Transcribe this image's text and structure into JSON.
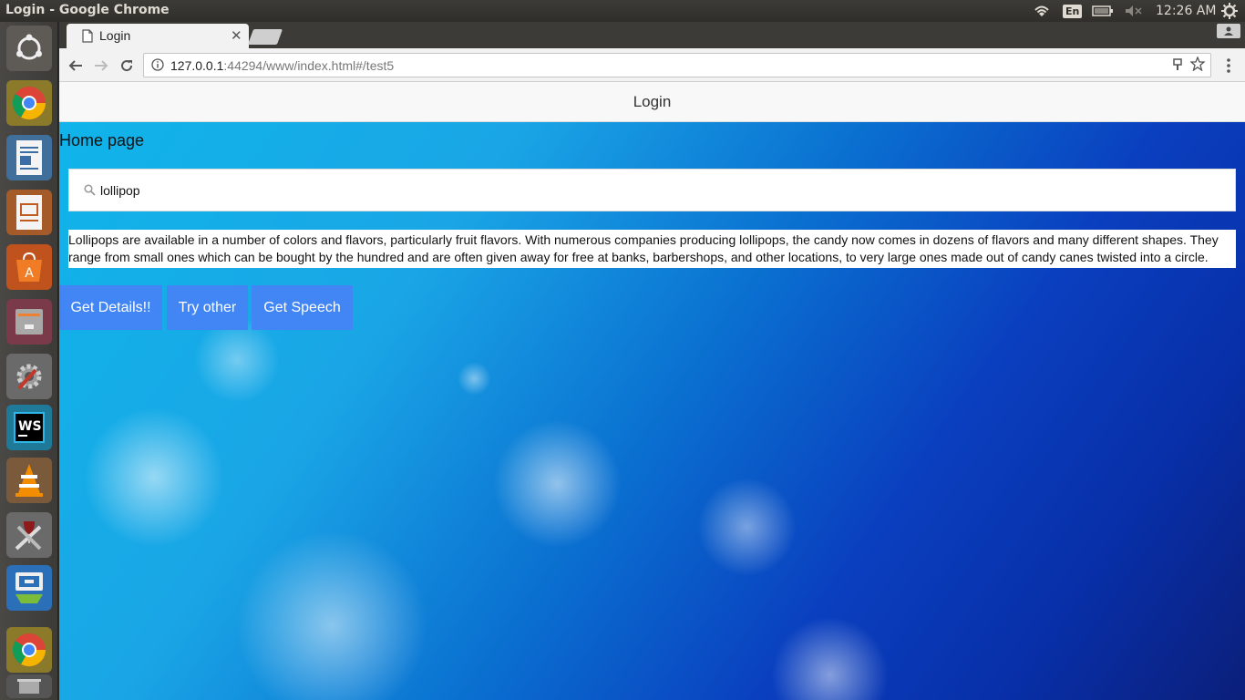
{
  "system": {
    "window_title": "Login - Google Chrome",
    "language": "En",
    "clock": "12:26 AM"
  },
  "launcher": {
    "items": [
      "ubuntu-logo-icon",
      "chrome-icon",
      "writer-icon",
      "impress-icon",
      "software-center-icon",
      "files-icon",
      "settings-icon",
      "webstorm-icon",
      "vlc-icon",
      "wine-tools-icon",
      "screenshot-icon",
      "chrome-icon",
      "trash-icon"
    ]
  },
  "browser": {
    "tab_title": "Login",
    "url_host": "127.0.0.1",
    "url_rest": ":44294/www/index.html#/test5"
  },
  "page": {
    "header_title": "Login",
    "heading": "Home page",
    "search": {
      "value": "lollipop"
    },
    "description": "Lollipops are available in a number of colors and flavors, particularly fruit flavors. With numerous companies producing lollipops, the candy now comes in dozens of flavors and many different shapes. They range from small ones which can be bought by the hundred and are often given away for free at banks, barbershops, and other locations, to very large ones made out of candy canes twisted into a circle.",
    "buttons": {
      "details": "Get Details!!",
      "try_other": "Try other",
      "speech": "Get Speech"
    },
    "colors": {
      "button": "#4285f4",
      "header_bg": "#f8f8f8"
    }
  }
}
